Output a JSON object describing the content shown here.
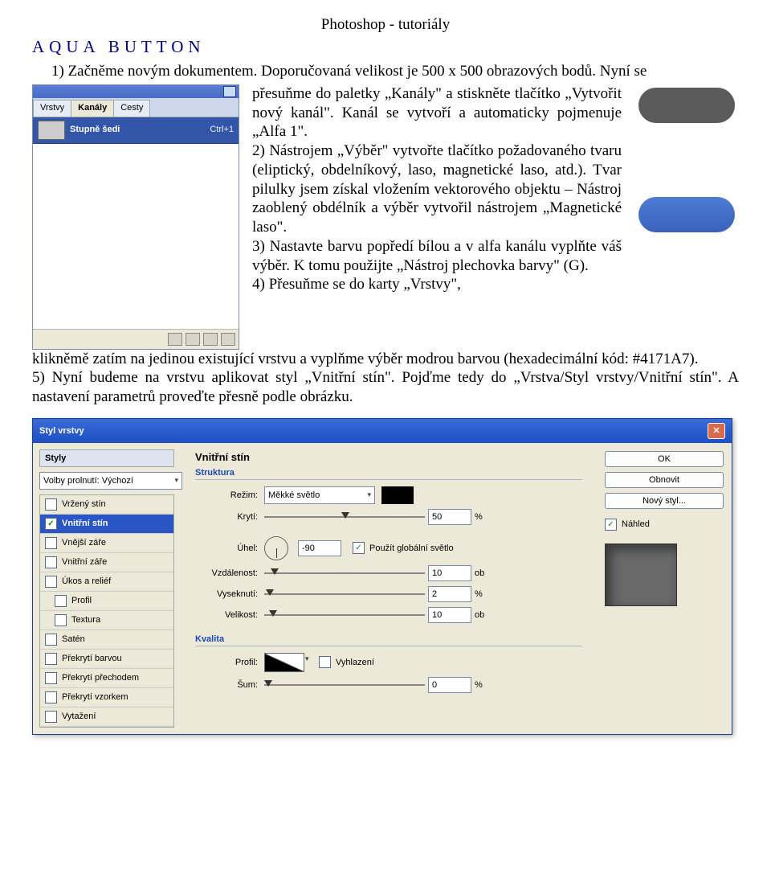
{
  "header": "Photoshop - tutoriály",
  "title": "AQUA BUTTON",
  "intro": "1)  Začněme novým dokumentem. Doporučovaná velikost je 500 x 500 obrazových bodů. Nyní se",
  "para_right": "přesuňme do paletky „Kanály\" a stiskněte tlačítko „Vytvořit nový kanál\". Kanál se vytvoří a automaticky pojmenuje „Alfa 1\".\n2) Nástrojem „Výběr\" vytvořte tlačítko požadovaného tvaru (eliptický, obdelníkový, laso, magnetické laso, atd.). Tvar pilulky jsem získal vložením vektorového objektu – Nástroj zaoblený obdélník a výběr vytvořil nástrojem „Magnetické laso\".\n3) Nastavte barvu popředí bílou a v alfa kanálu vyplňte váš výběr. K tomu použijte „Nástroj plechovka barvy\" (G).\n4) Přesuňme se do karty „Vrstvy\",",
  "after_float": "klikněmě zatím na jedinou existující vrstvu a vyplňme výběr modrou barvou (hexadecimální kód: #4171A7).\n5)  Nyní budeme na vrstvu aplikovat styl „Vnitřní stín\". Pojďme tedy do „Vrstva/Styl vrstvy/Vnitřní stín\". A nastavení parametrů proveďte přesně podle obrázku.",
  "channels": {
    "tabs": [
      "Vrstvy",
      "Kanály",
      "Cesty"
    ],
    "row_name": "Stupně šedi",
    "row_short": "Ctrl+1"
  },
  "dialog": {
    "title": "Styl vrstvy",
    "left_head": "Styly",
    "left_drop": "Volby prolnutí: Výchozí",
    "items": [
      {
        "label": "Vržený stín",
        "checked": false,
        "selected": false
      },
      {
        "label": "Vnitřní stín",
        "checked": true,
        "selected": true
      },
      {
        "label": "Vnější záře",
        "checked": false,
        "selected": false
      },
      {
        "label": "Vnitřní záře",
        "checked": false,
        "selected": false
      },
      {
        "label": "Úkos a reliéf",
        "checked": false,
        "selected": false
      },
      {
        "label": "Profil",
        "checked": false,
        "selected": false,
        "indent": true
      },
      {
        "label": "Textura",
        "checked": false,
        "selected": false,
        "indent": true
      },
      {
        "label": "Satén",
        "checked": false,
        "selected": false
      },
      {
        "label": "Překrytí barvou",
        "checked": false,
        "selected": false
      },
      {
        "label": "Překrytí přechodem",
        "checked": false,
        "selected": false
      },
      {
        "label": "Překrytí vzorkem",
        "checked": false,
        "selected": false
      },
      {
        "label": "Vytažení",
        "checked": false,
        "selected": false
      }
    ],
    "center_title": "Vnitřní stín",
    "group1": "Struktura",
    "rezim_label": "Režim:",
    "rezim_value": "Měkké světlo",
    "kryti_label": "Krytí:",
    "kryti_value": "50",
    "kryti_unit": "%",
    "uhel_label": "Úhel:",
    "uhel_value": "-90",
    "global_label": "Použít globální světlo",
    "vzdal_label": "Vzdálenost:",
    "vzdal_value": "10",
    "vzdal_unit": "ob",
    "vysek_label": "Vyseknutí:",
    "vysek_value": "2",
    "vysek_unit": "%",
    "velik_label": "Velikost:",
    "velik_value": "10",
    "velik_unit": "ob",
    "group2": "Kvalita",
    "profil_label": "Profil:",
    "vyhlaz_label": "Vyhlazení",
    "sum_label": "Šum:",
    "sum_value": "0",
    "sum_unit": "%",
    "btn_ok": "OK",
    "btn_reset": "Obnovit",
    "btn_new": "Nový styl...",
    "preview_label": "Náhled"
  }
}
